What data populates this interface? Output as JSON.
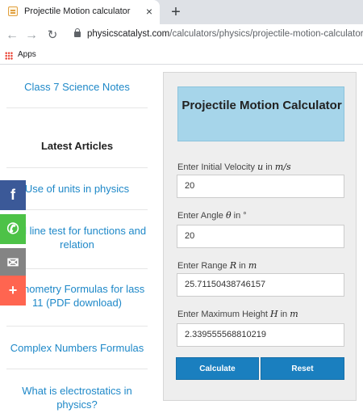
{
  "browser": {
    "tab_title": "Projectile Motion calculator",
    "tab_close": "×",
    "new_tab": "+",
    "url_host": "physicscatalyst.com",
    "url_path": "/calculators/physics/projectile-motion-calculator",
    "bookmarks": {
      "apps_label": "Apps"
    }
  },
  "sidebar": {
    "top_link": "Class 7 Science Notes",
    "latest_heading": "Latest Articles",
    "articles": [
      "Use of units in physics",
      "tical line test for functions and relation",
      "igonometry Formulas for lass 11 (PDF download)",
      "Complex Numbers Formulas",
      "What is electrostatics in physics?"
    ]
  },
  "share": {
    "facebook": "f",
    "whatsapp": "✆",
    "email": "✉",
    "more": "+"
  },
  "calculator": {
    "title": "Projectile Motion Calculator",
    "fields": [
      {
        "label_pre": "Enter Initial Velocity ",
        "symbol": "u",
        "label_mid": " in ",
        "unit": "m/s",
        "value": "20"
      },
      {
        "label_pre": "Enter Angle ",
        "symbol": "θ",
        "label_mid": " in ",
        "unit": "°",
        "value": "20"
      },
      {
        "label_pre": "Enter Range ",
        "symbol": "R",
        "label_mid": " in ",
        "unit": "m",
        "value": "25.71150438746157"
      },
      {
        "label_pre": "Enter Maximum Height ",
        "symbol": "H",
        "label_mid": " in ",
        "unit": "m",
        "value": "2.339555568810219"
      }
    ],
    "calculate_label": "Calculate",
    "reset_label": "Reset"
  },
  "colors": {
    "link": "#1e88c8",
    "title_box": "#a6d5ea",
    "button": "#1a7fbf",
    "facebook": "#3b5998",
    "whatsapp": "#4dc247",
    "email": "#848484",
    "more": "#ff6550"
  }
}
